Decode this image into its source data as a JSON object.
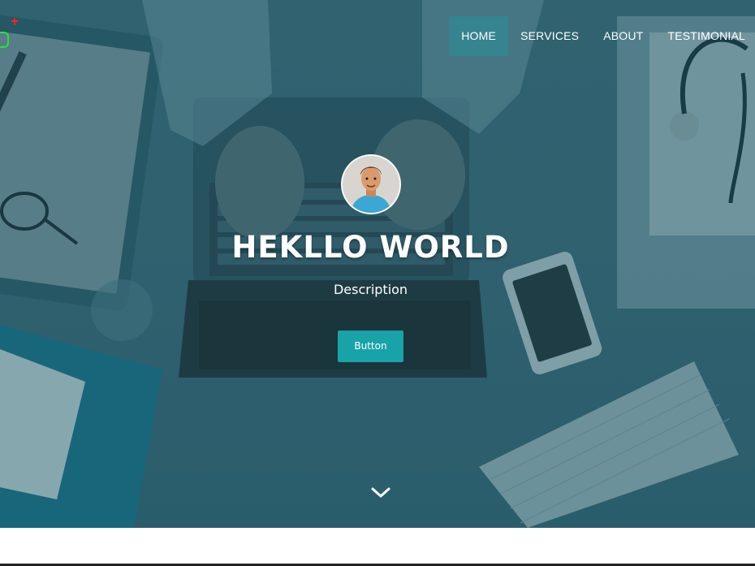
{
  "nav": {
    "items": [
      {
        "label": "HOME",
        "active": true
      },
      {
        "label": "SERVICES",
        "active": false
      },
      {
        "label": "ABOUT",
        "active": false
      },
      {
        "label": "TESTIMONIAL",
        "active": false
      }
    ]
  },
  "hero": {
    "title": "HEKLLO WORLD",
    "description": "Description",
    "button_label": "Button",
    "scroll_icon": "chevron-down-icon",
    "overlay_color": "#2f6a7a",
    "button_color": "#18a3a8"
  },
  "icons": {
    "corner": [
      "plus-icon",
      "rounded-square-icon"
    ]
  }
}
